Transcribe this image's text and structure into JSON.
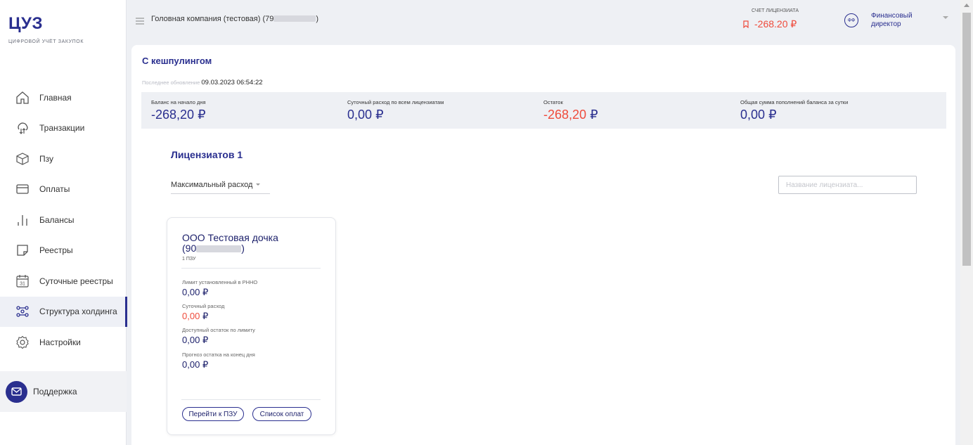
{
  "brand": {
    "logo": "ЦУЗ",
    "tagline": "цифровой учёт закупок"
  },
  "sidebar": {
    "items": [
      {
        "label": "Главная",
        "icon": "home-icon"
      },
      {
        "label": "Транзакции",
        "icon": "transactions-icon"
      },
      {
        "label": "Пзу",
        "icon": "box-icon"
      },
      {
        "label": "Оплаты",
        "icon": "payment-icon"
      },
      {
        "label": "Балансы",
        "icon": "balance-icon"
      },
      {
        "label": "Реестры",
        "icon": "registry-icon"
      },
      {
        "label": "Суточные реестры",
        "icon": "calendar-icon",
        "icon_text": "31"
      },
      {
        "label": "Структура холдинга",
        "icon": "hierarchy-icon",
        "active": true
      },
      {
        "label": "Настройки",
        "icon": "gear-icon"
      }
    ],
    "support_label": "Поддержка"
  },
  "header": {
    "company_prefix": "Головная компания (тестовая) (79",
    "company_suffix": ")",
    "account_label": "СЧЕТ ЛИЦЕНЗИАТА",
    "account_value": "-268.20 ₽",
    "user_initials": "ФФ",
    "user_role": "Финансовый директор"
  },
  "page": {
    "title": "С кешпулингом",
    "updated_label": "Последнее обновление",
    "updated_value": "09.03.2023 06:54:22"
  },
  "stats": [
    {
      "label": "Баланс на начало дня",
      "value": "-268,20",
      "currency": "₽",
      "color": "#2a2f8f"
    },
    {
      "label": "Суточный расход по всем лицензиатам",
      "value": "0,00",
      "currency": "₽",
      "color": "#2a2f8f"
    },
    {
      "label": "Остаток",
      "value": "-268,20",
      "currency": "₽",
      "color": "#ef4b3c"
    },
    {
      "label": "Общая сумма пополнений баланса за сутки",
      "value": "0,00",
      "currency": "₽",
      "color": "#2a2f8f"
    }
  ],
  "licensees": {
    "title": "Лицензиатов 1",
    "sort_label": "Максимальный расход",
    "search_placeholder": "Название лицензиата..."
  },
  "card": {
    "name_line1": "ООО Тестовая дочка",
    "name_prefix": "(90",
    "name_suffix": ")",
    "subtitle": "1 ПЗУ",
    "fields": [
      {
        "label": "Лимит установленный в РННО",
        "value": "0,00",
        "currency": "₽",
        "red": false
      },
      {
        "label": "Суточный расход",
        "value": "0,00",
        "currency": "₽",
        "red": true
      },
      {
        "label": "Доступный остаток по лимиту",
        "value": "0,00",
        "currency": "₽",
        "red": false
      },
      {
        "label": "Прогноз остатка на конец дня",
        "value": "0,00",
        "currency": "₽",
        "red": false
      }
    ],
    "btn_pzu": "Перейти к ПЗУ",
    "btn_payments": "Список оплат"
  },
  "colors": {
    "brand": "#2a2f8f",
    "negative": "#ef4b3c",
    "background": "#eef0f4"
  }
}
